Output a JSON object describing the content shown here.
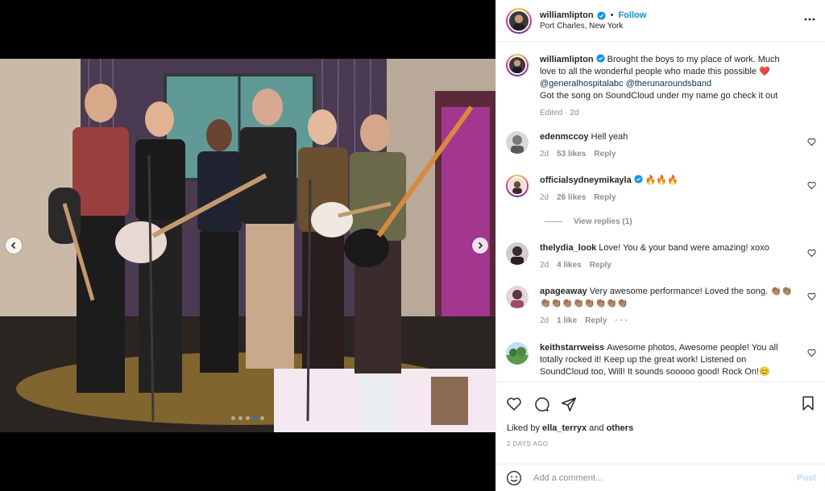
{
  "colors": {
    "link_blue": "#0095f6",
    "mention_blue": "#00376b",
    "muted": "#8e8e8e",
    "active_dot": "#1a73e8"
  },
  "media": {
    "prev_icon": "chevron-left-icon",
    "next_icon": "chevron-right-icon",
    "slide_count": 5,
    "active_slide": 3
  },
  "header": {
    "username": "williamlipton",
    "separator": "•",
    "follow_label": "Follow",
    "location": "Port Charles, New York",
    "more_icon": "more-horizontal-icon"
  },
  "caption": {
    "username": "williamlipton",
    "text_before": "Brought the boys to my place of work. Much love to all the wonderful people who made this possible ❤️",
    "mention_1": "@generalhospitalabc",
    "mention_2": "@therunaroundsband",
    "text_after": "Got the song on SoundCloud under my name go check it out",
    "meta": "Edited · 2d"
  },
  "comments": [
    {
      "author": "edenmccoy",
      "text": "Hell yeah",
      "age": "2d",
      "likes": "53 likes",
      "reply": "Reply"
    },
    {
      "author": "officialsydneymikayla",
      "text": "🔥🔥🔥",
      "age": "2d",
      "likes": "26 likes",
      "reply": "Reply"
    },
    {
      "author": "thelydia_look",
      "text": "Love! You & your band were amazing! xoxo",
      "age": "2d",
      "likes": "4 likes",
      "reply": "Reply"
    },
    {
      "author": "apageaway",
      "text": "Very awesome performance! Loved the song. 👏🏽👏🏽👏🏽👏🏽👏🏽👏🏽👏🏽👏🏽👏🏽👏🏽",
      "age": "2d",
      "likes": "1 like",
      "reply": "Reply",
      "more": "· · ·"
    },
    {
      "author": "keithstarrweiss",
      "text": "Awesome photos, Awesome people! You all totally rocked it! Keep up the great work! Listened on SoundCloud too, Will! It sounds sooooo good! Rock On!😊"
    }
  ],
  "view_replies": "View replies (1)",
  "actions": {
    "like_icon": "heart-icon",
    "comment_icon": "comment-icon",
    "share_icon": "share-icon",
    "save_icon": "bookmark-icon",
    "liked_by_prefix": "Liked by",
    "liked_by_user": "ella_terryx",
    "liked_by_and": "and",
    "liked_by_others": "others",
    "date": "2 DAYS AGO"
  },
  "composer": {
    "emoji_icon": "emoji-icon",
    "placeholder": "Add a comment...",
    "post_label": "Post"
  }
}
